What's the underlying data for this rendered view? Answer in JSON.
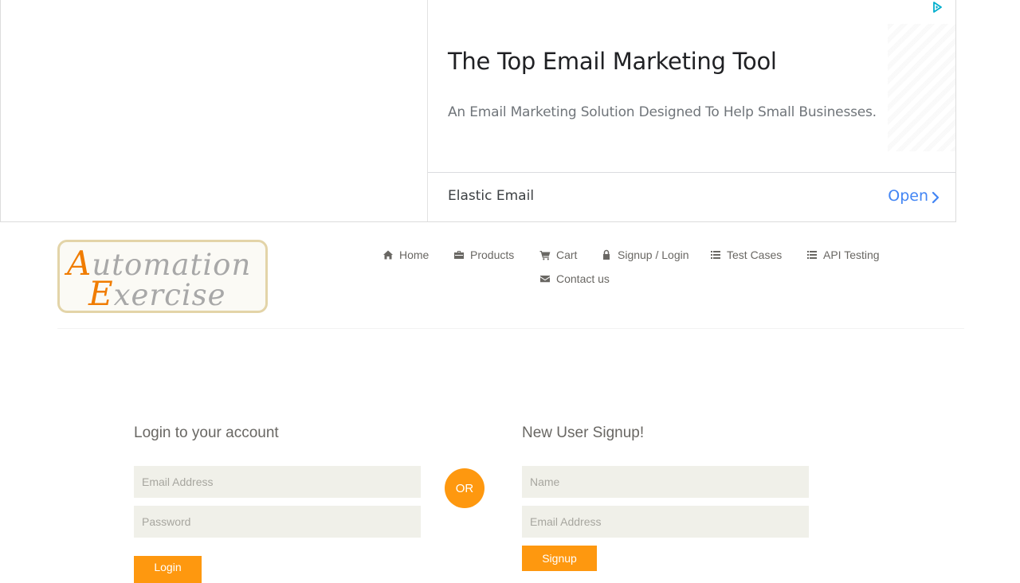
{
  "ad": {
    "title": "The Top Email Marketing Tool",
    "subtitle": "An Email Marketing Solution Designed To Help Small Businesses.",
    "advertiser": "Elastic Email",
    "cta": "Open"
  },
  "logo": {
    "line1_cap": "A",
    "line1_rest": "utomation",
    "line2_cap": "E",
    "line2_rest": "xercise"
  },
  "nav": {
    "items": [
      {
        "label": "Home",
        "icon": "home-icon"
      },
      {
        "label": "Products",
        "icon": "briefcase-icon"
      },
      {
        "label": "Cart",
        "icon": "cart-icon"
      },
      {
        "label": "Signup / Login",
        "icon": "lock-icon"
      },
      {
        "label": "Test Cases",
        "icon": "list-icon"
      },
      {
        "label": "API Testing",
        "icon": "list-icon"
      },
      {
        "label": "Contact us",
        "icon": "envelope-icon"
      }
    ]
  },
  "login": {
    "title": "Login to your account",
    "email_placeholder": "Email Address",
    "password_placeholder": "Password",
    "button": "Login"
  },
  "or_label": "OR",
  "signup": {
    "title": "New User Signup!",
    "name_placeholder": "Name",
    "email_placeholder": "Email Address",
    "button": "Signup"
  },
  "colors": {
    "accent": "#fe980f",
    "field_bg": "#f0f0e9",
    "text": "#696763",
    "ad_link": "#4285f4"
  }
}
